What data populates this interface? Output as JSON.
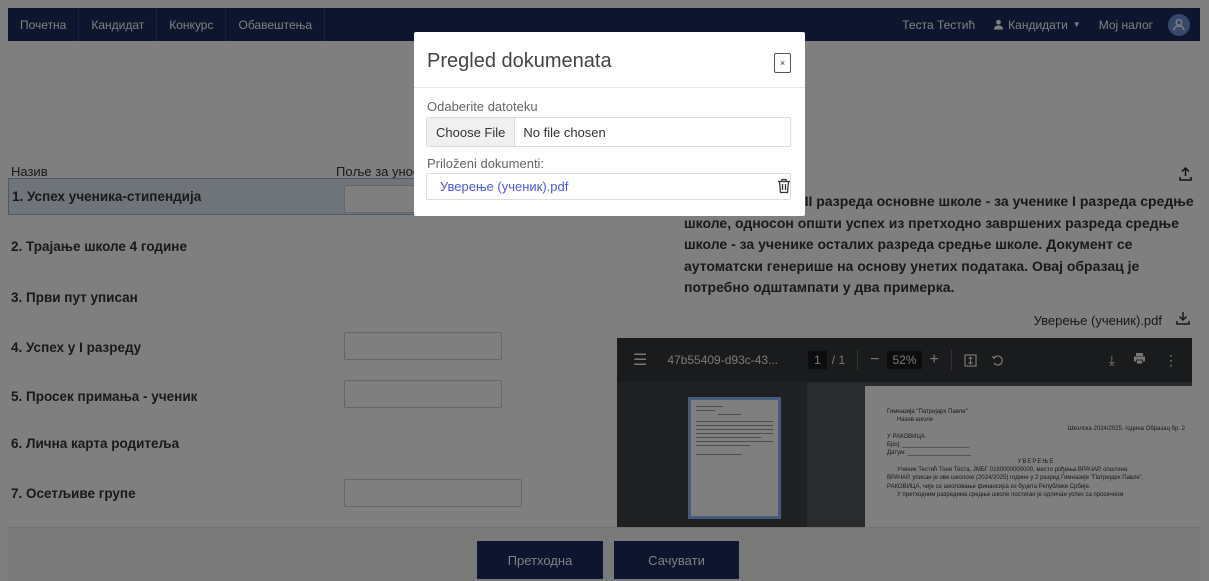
{
  "nav": {
    "left": [
      "Почетна",
      "Кандидат",
      "Конкурс",
      "Обавештења"
    ],
    "user_name": "Теста Тестић",
    "candidates_menu": "Кандидати",
    "account": "Мој налог"
  },
  "table": {
    "col_name": "Назив",
    "col_field": "Поље за унос",
    "rows": [
      "1. Успех ученика-стипендија",
      "2. Трајање школе 4 године",
      "3. Први пут уписан",
      "4. Успех у I разреду",
      "5. Просек примања - ученик",
      "6. Лична карта родитеља",
      "7. Осетљиве групе"
    ]
  },
  "right": {
    "description": "ченика од V до VIII разреда основне школе - за ученике I разреда средње школе, односон општи успех из претходно завршених разреда средње школе - за ученике осталих разреда средње школе. Документ се аутоматски генерише на основу унетих података. Овај образац је потребно одштампати у два примерка.",
    "file_name": "Уверење (ученик).pdf"
  },
  "pdf": {
    "doc_name": "47b55409-d93c-43...",
    "page": "1",
    "page_total": "/ 1",
    "zoom": "52%",
    "lines": [
      "Гимназија \"Патријарх Павле\"",
      "Назив школе",
      "Школска 2024/2025. година   Образац бр. 2",
      "У РАКОВИЦА",
      "Број: ____________________",
      "Датум: ___________________",
      "УВЕРЕЊЕ",
      "Ученик Тестић Тони Теста, ЈМБГ 0180000000000, место рођења ВРАЧАР, општина",
      "ВРАЧАР, уписан је ове школске (2024/2025) године у 2 разред Гимназије \"Патријарх Павле\",",
      "РАКОВИЦА, чије се школовање финансира из буџета Републике Србије.",
      "У претходним разредима средње школе постигао је одличан успех са просечном"
    ]
  },
  "buttons": {
    "previous": "Претходна",
    "save": "Сачувати"
  },
  "modal": {
    "title": "Pregled dokumenata",
    "close": "×",
    "file_label": "Odaberite datoteku",
    "choose_file": "Choose File",
    "no_file": "No file chosen",
    "attached_label": "Priloženi dokumenti:",
    "attached_file": "Уверење (ученик).pdf"
  }
}
